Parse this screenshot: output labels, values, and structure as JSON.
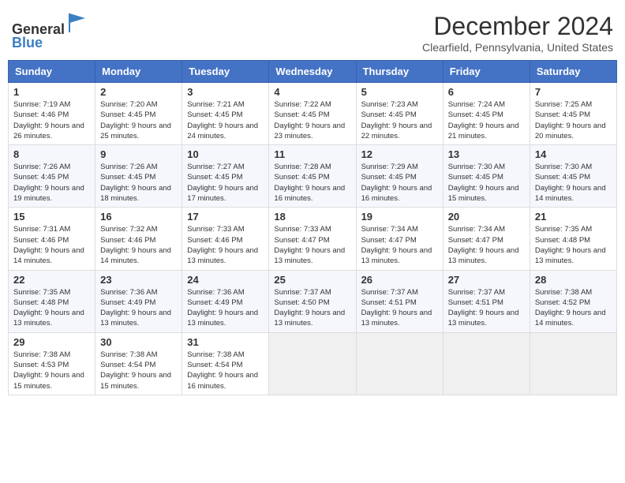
{
  "header": {
    "logo_line1": "General",
    "logo_line2": "Blue",
    "month_title": "December 2024",
    "location": "Clearfield, Pennsylvania, United States"
  },
  "days_of_week": [
    "Sunday",
    "Monday",
    "Tuesday",
    "Wednesday",
    "Thursday",
    "Friday",
    "Saturday"
  ],
  "weeks": [
    [
      {
        "day": "1",
        "sunrise": "Sunrise: 7:19 AM",
        "sunset": "Sunset: 4:46 PM",
        "daylight": "Daylight: 9 hours and 26 minutes."
      },
      {
        "day": "2",
        "sunrise": "Sunrise: 7:20 AM",
        "sunset": "Sunset: 4:45 PM",
        "daylight": "Daylight: 9 hours and 25 minutes."
      },
      {
        "day": "3",
        "sunrise": "Sunrise: 7:21 AM",
        "sunset": "Sunset: 4:45 PM",
        "daylight": "Daylight: 9 hours and 24 minutes."
      },
      {
        "day": "4",
        "sunrise": "Sunrise: 7:22 AM",
        "sunset": "Sunset: 4:45 PM",
        "daylight": "Daylight: 9 hours and 23 minutes."
      },
      {
        "day": "5",
        "sunrise": "Sunrise: 7:23 AM",
        "sunset": "Sunset: 4:45 PM",
        "daylight": "Daylight: 9 hours and 22 minutes."
      },
      {
        "day": "6",
        "sunrise": "Sunrise: 7:24 AM",
        "sunset": "Sunset: 4:45 PM",
        "daylight": "Daylight: 9 hours and 21 minutes."
      },
      {
        "day": "7",
        "sunrise": "Sunrise: 7:25 AM",
        "sunset": "Sunset: 4:45 PM",
        "daylight": "Daylight: 9 hours and 20 minutes."
      }
    ],
    [
      {
        "day": "8",
        "sunrise": "Sunrise: 7:26 AM",
        "sunset": "Sunset: 4:45 PM",
        "daylight": "Daylight: 9 hours and 19 minutes."
      },
      {
        "day": "9",
        "sunrise": "Sunrise: 7:26 AM",
        "sunset": "Sunset: 4:45 PM",
        "daylight": "Daylight: 9 hours and 18 minutes."
      },
      {
        "day": "10",
        "sunrise": "Sunrise: 7:27 AM",
        "sunset": "Sunset: 4:45 PM",
        "daylight": "Daylight: 9 hours and 17 minutes."
      },
      {
        "day": "11",
        "sunrise": "Sunrise: 7:28 AM",
        "sunset": "Sunset: 4:45 PM",
        "daylight": "Daylight: 9 hours and 16 minutes."
      },
      {
        "day": "12",
        "sunrise": "Sunrise: 7:29 AM",
        "sunset": "Sunset: 4:45 PM",
        "daylight": "Daylight: 9 hours and 16 minutes."
      },
      {
        "day": "13",
        "sunrise": "Sunrise: 7:30 AM",
        "sunset": "Sunset: 4:45 PM",
        "daylight": "Daylight: 9 hours and 15 minutes."
      },
      {
        "day": "14",
        "sunrise": "Sunrise: 7:30 AM",
        "sunset": "Sunset: 4:45 PM",
        "daylight": "Daylight: 9 hours and 14 minutes."
      }
    ],
    [
      {
        "day": "15",
        "sunrise": "Sunrise: 7:31 AM",
        "sunset": "Sunset: 4:46 PM",
        "daylight": "Daylight: 9 hours and 14 minutes."
      },
      {
        "day": "16",
        "sunrise": "Sunrise: 7:32 AM",
        "sunset": "Sunset: 4:46 PM",
        "daylight": "Daylight: 9 hours and 14 minutes."
      },
      {
        "day": "17",
        "sunrise": "Sunrise: 7:33 AM",
        "sunset": "Sunset: 4:46 PM",
        "daylight": "Daylight: 9 hours and 13 minutes."
      },
      {
        "day": "18",
        "sunrise": "Sunrise: 7:33 AM",
        "sunset": "Sunset: 4:47 PM",
        "daylight": "Daylight: 9 hours and 13 minutes."
      },
      {
        "day": "19",
        "sunrise": "Sunrise: 7:34 AM",
        "sunset": "Sunset: 4:47 PM",
        "daylight": "Daylight: 9 hours and 13 minutes."
      },
      {
        "day": "20",
        "sunrise": "Sunrise: 7:34 AM",
        "sunset": "Sunset: 4:47 PM",
        "daylight": "Daylight: 9 hours and 13 minutes."
      },
      {
        "day": "21",
        "sunrise": "Sunrise: 7:35 AM",
        "sunset": "Sunset: 4:48 PM",
        "daylight": "Daylight: 9 hours and 13 minutes."
      }
    ],
    [
      {
        "day": "22",
        "sunrise": "Sunrise: 7:35 AM",
        "sunset": "Sunset: 4:48 PM",
        "daylight": "Daylight: 9 hours and 13 minutes."
      },
      {
        "day": "23",
        "sunrise": "Sunrise: 7:36 AM",
        "sunset": "Sunset: 4:49 PM",
        "daylight": "Daylight: 9 hours and 13 minutes."
      },
      {
        "day": "24",
        "sunrise": "Sunrise: 7:36 AM",
        "sunset": "Sunset: 4:49 PM",
        "daylight": "Daylight: 9 hours and 13 minutes."
      },
      {
        "day": "25",
        "sunrise": "Sunrise: 7:37 AM",
        "sunset": "Sunset: 4:50 PM",
        "daylight": "Daylight: 9 hours and 13 minutes."
      },
      {
        "day": "26",
        "sunrise": "Sunrise: 7:37 AM",
        "sunset": "Sunset: 4:51 PM",
        "daylight": "Daylight: 9 hours and 13 minutes."
      },
      {
        "day": "27",
        "sunrise": "Sunrise: 7:37 AM",
        "sunset": "Sunset: 4:51 PM",
        "daylight": "Daylight: 9 hours and 13 minutes."
      },
      {
        "day": "28",
        "sunrise": "Sunrise: 7:38 AM",
        "sunset": "Sunset: 4:52 PM",
        "daylight": "Daylight: 9 hours and 14 minutes."
      }
    ],
    [
      {
        "day": "29",
        "sunrise": "Sunrise: 7:38 AM",
        "sunset": "Sunset: 4:53 PM",
        "daylight": "Daylight: 9 hours and 15 minutes."
      },
      {
        "day": "30",
        "sunrise": "Sunrise: 7:38 AM",
        "sunset": "Sunset: 4:54 PM",
        "daylight": "Daylight: 9 hours and 15 minutes."
      },
      {
        "day": "31",
        "sunrise": "Sunrise: 7:38 AM",
        "sunset": "Sunset: 4:54 PM",
        "daylight": "Daylight: 9 hours and 16 minutes."
      },
      null,
      null,
      null,
      null
    ]
  ]
}
